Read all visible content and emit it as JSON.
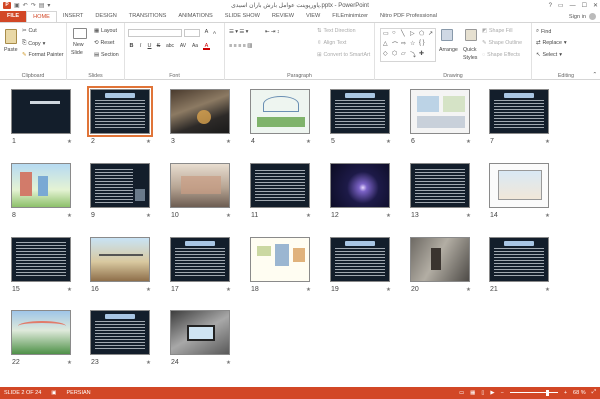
{
  "window": {
    "title": "پاورپوینت عوامل بارش باران اسیدی.pptx - PowerPoint",
    "app_icon": "P",
    "sign_in": "Sign in",
    "minimize": "—",
    "maximize": "☐",
    "close": "✕",
    "help": "?"
  },
  "tabs": [
    "FILE",
    "HOME",
    "INSERT",
    "DESIGN",
    "TRANSITIONS",
    "ANIMATIONS",
    "SLIDE SHOW",
    "REVIEW",
    "VIEW",
    "FILEminimizer",
    "Nitro PDF Professional"
  ],
  "active_tab": "HOME",
  "ribbon": {
    "clipboard": {
      "label": "Clipboard",
      "paste": "Paste",
      "cut": "Cut",
      "copy": "Copy",
      "format_painter": "Format Painter"
    },
    "slides": {
      "label": "Slides",
      "new_slide": "New",
      "new_slide2": "Slide",
      "layout": "Layout",
      "reset": "Reset",
      "section": "Section"
    },
    "font": {
      "label": "Font",
      "bold": "B",
      "italic": "I",
      "underline": "U",
      "strike": "S",
      "shadow": "abc",
      "spacing": "AV",
      "case": "Aa",
      "color": "A"
    },
    "paragraph": {
      "label": "Paragraph",
      "text_direction": "Text Direction",
      "align_text": "Align Text",
      "convert_smartart": "Convert to SmartArt"
    },
    "drawing": {
      "label": "Drawing",
      "arrange": "Arrange",
      "quick_styles": "Quick",
      "quick_styles2": "Styles",
      "shape_fill": "Shape Fill",
      "shape_outline": "Shape Outline",
      "shape_effects": "Shape Effects"
    },
    "editing": {
      "label": "Editing",
      "find": "Find",
      "replace": "Replace",
      "select": "Select"
    }
  },
  "slides": [
    {
      "num": "1"
    },
    {
      "num": "2"
    },
    {
      "num": "3"
    },
    {
      "num": "4"
    },
    {
      "num": "5"
    },
    {
      "num": "6"
    },
    {
      "num": "7"
    },
    {
      "num": "8"
    },
    {
      "num": "9"
    },
    {
      "num": "10"
    },
    {
      "num": "11"
    },
    {
      "num": "12"
    },
    {
      "num": "13"
    },
    {
      "num": "14"
    },
    {
      "num": "15"
    },
    {
      "num": "16"
    },
    {
      "num": "17"
    },
    {
      "num": "18"
    },
    {
      "num": "19"
    },
    {
      "num": "20"
    },
    {
      "num": "21"
    },
    {
      "num": "22"
    },
    {
      "num": "23"
    },
    {
      "num": "24"
    }
  ],
  "slide_star": "★",
  "selected_slide": 2,
  "status": {
    "slide_of": "SLIDE 2 OF 24",
    "language": "PERSIAN",
    "zoom": "68 %",
    "zoom_minus": "−",
    "zoom_plus": "+"
  },
  "colors": {
    "accent": "#d24726",
    "selection": "#e07438"
  }
}
